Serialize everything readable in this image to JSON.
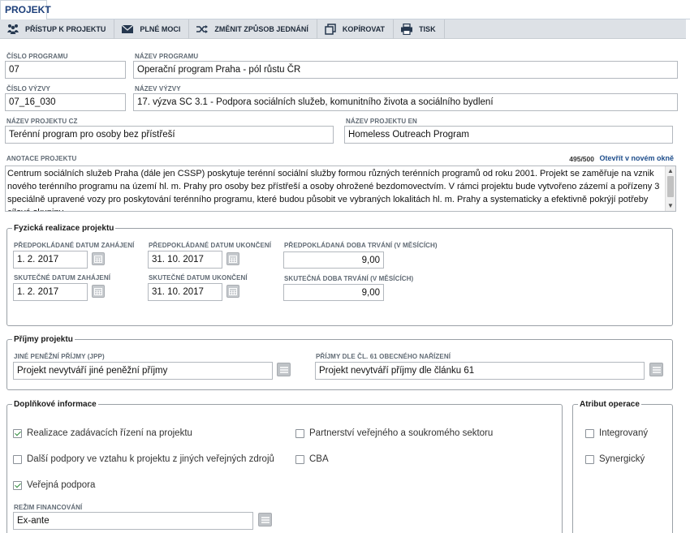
{
  "tab": {
    "label": "PROJEKT"
  },
  "toolbar": [
    {
      "label": "PŘÍSTUP K PROJEKTU",
      "icon": "people-icon"
    },
    {
      "label": "PLNÉ MOCI",
      "icon": "envelope-icon"
    },
    {
      "label": "ZMĚNIT ZPŮSOB JEDNÁNÍ",
      "icon": "shuffle-icon"
    },
    {
      "label": "KOPÍROVAT",
      "icon": "copy-icon"
    },
    {
      "label": "TISK",
      "icon": "printer-icon"
    }
  ],
  "program": {
    "number_label": "ČÍSLO PROGRAMU",
    "number": "07",
    "name_label": "NÁZEV PROGRAMU",
    "name": "Operační program Praha - pól růstu ČR"
  },
  "call": {
    "number_label": "ČÍSLO VÝZVY",
    "number": "07_16_030",
    "name_label": "NÁZEV VÝZVY",
    "name": "17. výzva SC 3.1 - Podpora sociálních služeb, komunitního života a sociálního bydlení"
  },
  "project_name": {
    "cz_label": "NÁZEV PROJEKTU CZ",
    "cz": "Terénní program pro osoby bez přístřeší",
    "en_label": "NÁZEV PROJEKTU EN",
    "en": "Homeless Outreach Program"
  },
  "annotation": {
    "label": "ANOTACE PROJEKTU",
    "counter": "495/500",
    "open_new_window": "Otevřít v novém okně",
    "text": "Centrum sociálních služeb Praha (dále jen CSSP) poskytuje terénní sociální služby formou různých terénních programů od roku 2001. Projekt se zaměřuje na vznik nového terénního programu na území hl. m. Prahy pro osoby bez přístřeší  a osoby ohrožené bezdomovectvím. V rámci projektu bude vytvořeno zázemí a pořízeny 3 speciálně upravené vozy pro poskytování terénního programu, které budou působit ve vybraných lokalitách hl. m. Prahy  a systematicky a efektivně pokrýjí potřeby cílové skupiny."
  },
  "realization": {
    "legend": "Fyzická realizace projektu",
    "planned_start_label": "PŘEDPOKLÁDANÉ DATUM ZAHÁJENÍ",
    "planned_start": "1. 2. 2017",
    "planned_end_label": "PŘEDPOKLÁDANÉ DATUM UKONČENÍ",
    "planned_end": "31. 10. 2017",
    "planned_duration_label": "PŘEDPOKLÁDANÁ DOBA TRVÁNÍ (V MĚSÍCÍCH)",
    "planned_duration": "9,00",
    "actual_start_label": "SKUTEČNÉ DATUM ZAHÁJENÍ",
    "actual_start": "1. 2. 2017",
    "actual_end_label": "SKUTEČNÉ DATUM UKONČENÍ",
    "actual_end": "31. 10. 2017",
    "actual_duration_label": "SKUTEČNÁ DOBA TRVÁNÍ (V MĚSÍCÍCH)",
    "actual_duration": "9,00"
  },
  "income": {
    "legend": "Příjmy projektu",
    "other_label": "JINÉ PENĚŽNÍ PŘÍJMY (JPP)",
    "other": "Projekt nevytváří jiné peněžní příjmy",
    "art61_label": "PŘÍJMY DLE ČL. 61 OBECNÉHO NAŘÍZENÍ",
    "art61": "Projekt nevytváří příjmy dle článku 61"
  },
  "additional": {
    "legend": "Doplňkové informace",
    "checks": [
      {
        "label": "Realizace zadávacích řízení na projektu",
        "checked": true
      },
      {
        "label": "Partnerství veřejného a soukromého sektoru",
        "checked": false
      },
      {
        "label": "Další podpory ve vztahu k projektu z jiných veřejných zdrojů",
        "checked": false
      },
      {
        "label": "CBA",
        "checked": false
      },
      {
        "label": "Veřejná podpora",
        "checked": true
      }
    ],
    "funding_label": "REŽIM FINANCOVÁNÍ",
    "funding": "Ex-ante"
  },
  "operation": {
    "legend": "Atribut operace",
    "checks": [
      {
        "label": "Integrovaný",
        "checked": false
      },
      {
        "label": "Synergický",
        "checked": false
      }
    ]
  }
}
